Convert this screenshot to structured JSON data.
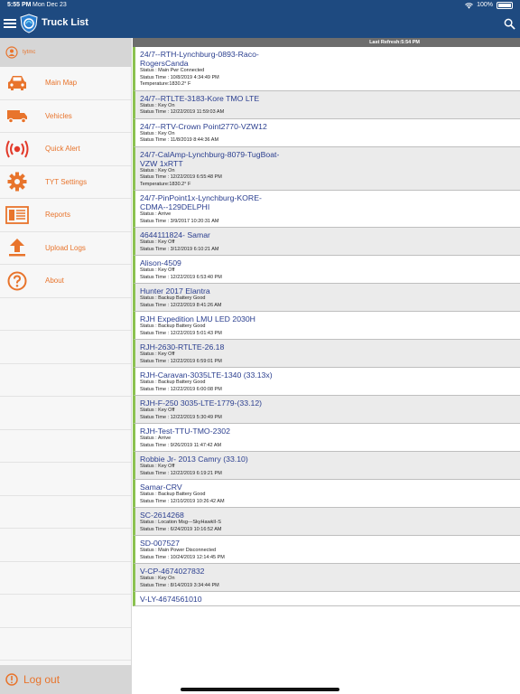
{
  "status_bar": {
    "time": "5:55 PM",
    "date": "Mon Dec 23",
    "battery": "100%"
  },
  "header": {
    "title": "Truck List"
  },
  "sidebar": {
    "user": "tytmc",
    "items": [
      {
        "label": "Main Map",
        "icon": "car-icon"
      },
      {
        "label": "Vehicles",
        "icon": "truck-icon"
      },
      {
        "label": "Quick Alert",
        "icon": "alert-icon"
      },
      {
        "label": "TYT Settings",
        "icon": "gear-icon"
      },
      {
        "label": "Reports",
        "icon": "reports-icon"
      },
      {
        "label": "Upload Logs",
        "icon": "upload-icon"
      },
      {
        "label": "About",
        "icon": "help-icon"
      }
    ],
    "logout": "Log out"
  },
  "main": {
    "refresh": "Last Refresh:5:54 PM",
    "trucks": [
      {
        "name": "24/7--RTH-Lynchburg-0893-Raco-RogersCanda",
        "lines": [
          "Status : Main Pwr Connected",
          "Status Time : 10/8/2019 4:34:49 PM",
          "Temperature:1830.2° F"
        ]
      },
      {
        "name": "24/7--RTLTE-3183-Kore TMO LTE",
        "lines": [
          "Status : Key On",
          "Status Time : 12/22/2019 11:59:03 AM"
        ]
      },
      {
        "name": "24/7--RTV-Crown Point2770-VZW12",
        "lines": [
          "Status : Key On",
          "Status Time : 11/8/2019 8:44:36 AM"
        ]
      },
      {
        "name": "24/7-CalAmp-Lynchburg-8079-TugBoat-VZW 1xRTT",
        "lines": [
          "Status : Key On",
          "Status Time : 12/22/2019 6:55:48 PM",
          "Temperature:1830.2° F"
        ]
      },
      {
        "name": "24/7-PinPoint1x-Lynchburg-KORE-CDMA--129DELPHI",
        "lines": [
          "Status : Arrive",
          "Status Time : 3/9/2017 10:20:31 AM"
        ]
      },
      {
        "name": "4644111824- Samar",
        "lines": [
          "Status : Key Off",
          "Status Time : 3/12/2019 6:10:21 AM"
        ]
      },
      {
        "name": "Alison-4509",
        "lines": [
          "Status : Key Off",
          "Status Time : 12/22/2019 6:53:40 PM"
        ]
      },
      {
        "name": "Hunter 2017 Elantra",
        "lines": [
          "Status : Backup Battery Good",
          "Status Time : 12/22/2019 8:41:26 AM"
        ]
      },
      {
        "name": "RJH Expedition LMU LED 2030H",
        "lines": [
          "Status : Backup Battery Good",
          "Status Time : 12/22/2019 5:01:43 PM"
        ]
      },
      {
        "name": "RJH-2630-RTLTE-26.18",
        "lines": [
          "Status : Key Off",
          "Status Time : 12/22/2019 6:59:01 PM"
        ]
      },
      {
        "name": "RJH-Caravan-3035LTE-1340 (33.13x)",
        "lines": [
          "Status : Backup Battery Good",
          "Status Time : 12/22/2019 6:00:08 PM"
        ]
      },
      {
        "name": "RJH-F-250 3035-LTE-1779-(33.12)",
        "lines": [
          "Status : Key Off",
          "Status Time : 12/22/2019 5:30:49 PM"
        ]
      },
      {
        "name": "RJH-Test-TTU-TMO-2302",
        "lines": [
          "Status : Arrive",
          "Status Time : 9/26/2019 11:47:42 AM"
        ]
      },
      {
        "name": "Robbie Jr- 2013 Camry (33.10)",
        "lines": [
          "Status : Key Off",
          "Status Time : 12/22/2019 6:19:21 PM"
        ]
      },
      {
        "name": "Samar-CRV",
        "lines": [
          "Status : Backup Battery Good",
          "Status Time : 12/10/2019 10:26:42 AM"
        ]
      },
      {
        "name": "SC-2614268",
        "lines": [
          "Status : Location Msg---SkyHawkII-S",
          "Status Time : 6/24/2019 10:16:52 AM"
        ]
      },
      {
        "name": "SD-007527",
        "lines": [
          "Status : Main Power Disconnected",
          "Status Time : 10/24/2019 12:14:45 PM"
        ]
      },
      {
        "name": "V-CP-4674027832",
        "lines": [
          "Status : Key On",
          "Status Time : 8/14/2019 3:34:44 PM"
        ]
      },
      {
        "name": "V-LY-4674561010",
        "lines": []
      }
    ]
  },
  "colors": {
    "header": "#1e4a80",
    "accent": "#e8742c",
    "row_marker": "#8cc251",
    "truck_name": "#2a3e8f"
  }
}
